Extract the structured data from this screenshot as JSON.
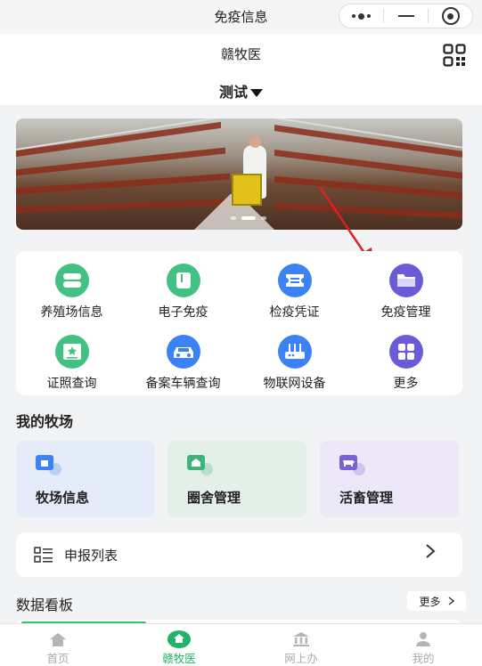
{
  "window": {
    "title": "免疫信息"
  },
  "header": {
    "app_title": "赣牧医",
    "farm_selector": "测试"
  },
  "menu": [
    {
      "label": "养殖场信息",
      "icon": "farm-info-icon",
      "color": "#42c183"
    },
    {
      "label": "电子免疫",
      "icon": "e-immunization-icon",
      "color": "#42c183"
    },
    {
      "label": "检疫凭证",
      "icon": "quarantine-certificate-icon",
      "color": "#3b82f6"
    },
    {
      "label": "免疫管理",
      "icon": "folder-icon",
      "color": "#6b5bd6"
    },
    {
      "label": "证照查询",
      "icon": "license-query-icon",
      "color": "#42c183"
    },
    {
      "label": "备案车辆查询",
      "icon": "car-icon",
      "color": "#3b82f6"
    },
    {
      "label": "物联网设备",
      "icon": "router-icon",
      "color": "#3b82f6"
    },
    {
      "label": "更多",
      "icon": "grid-more-icon",
      "color": "#6b5bd6"
    }
  ],
  "my_farm": {
    "title": "我的牧场",
    "cards": [
      {
        "label": "牧场信息",
        "icon": "farm-card-icon",
        "bg": "#e4ecfa",
        "color": "#3b82f6"
      },
      {
        "label": "圈舍管理",
        "icon": "pen-card-icon",
        "bg": "#e3f0ea",
        "color": "#3fb37c"
      },
      {
        "label": "活畜管理",
        "icon": "livestock-card-icon",
        "bg": "#ece8f8",
        "color": "#7b61d6"
      }
    ]
  },
  "report": {
    "label": "申报列表"
  },
  "dashboard": {
    "title": "数据看板",
    "more": "更多"
  },
  "tabbar": [
    {
      "label": "首页",
      "icon": "home-icon",
      "active": false
    },
    {
      "label": "赣牧医",
      "icon": "ganmuyi-home-icon",
      "active": true
    },
    {
      "label": "网上办",
      "icon": "bank-icon",
      "active": false
    },
    {
      "label": "我的",
      "icon": "user-icon",
      "active": false
    }
  ]
}
